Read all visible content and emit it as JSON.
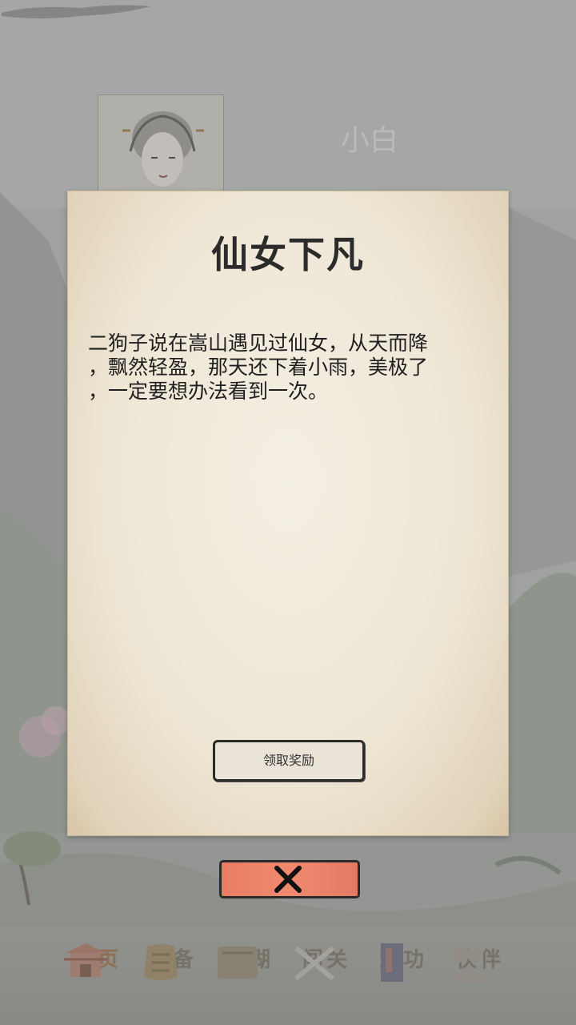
{
  "profile": {
    "name": "小白"
  },
  "event": {
    "title": "仙女下凡",
    "lines": [
      "二狗子说在嵩山遇见过仙女，从天而降",
      "，飘然轻盈，那天还下着小雨，美极了",
      "，一定要想办法看到一次。"
    ],
    "claim_label": "领取奖励"
  },
  "nav": {
    "items": [
      {
        "label": "首页",
        "icon": "pagoda-icon"
      },
      {
        "label": "装备",
        "icon": "armor-icon"
      },
      {
        "label": "江湖",
        "icon": "map-icon"
      },
      {
        "label": "闯关",
        "icon": "swords-icon"
      },
      {
        "label": "武功",
        "icon": "manual-icon"
      },
      {
        "label": "伙伴",
        "icon": "companions-icon"
      }
    ]
  },
  "colors": {
    "close_button": "#ef8a6f",
    "paper": "#efe7d6",
    "title_text": "#2b2b2b"
  }
}
